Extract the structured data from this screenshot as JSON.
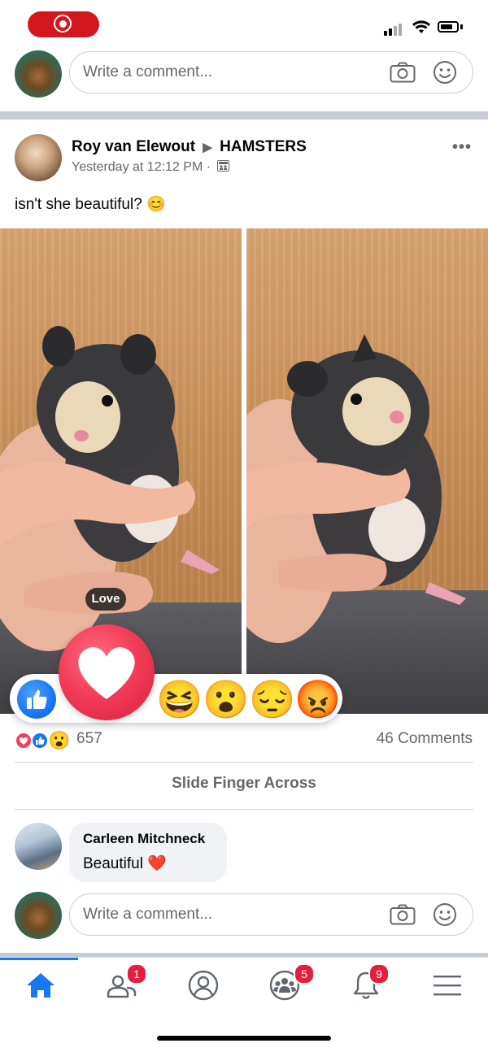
{
  "status_bar": {
    "recording": "screen-recording-indicator",
    "icons": [
      "signal-icon",
      "wifi-icon",
      "battery-icon"
    ]
  },
  "top_comment_box": {
    "placeholder": "Write a comment..."
  },
  "post": {
    "author": "Roy van Elewout",
    "arrow": "▶",
    "group": "HAMSTERS",
    "timestamp": "Yesterday at 12:12 PM ·",
    "text": "isn't she beautiful? 😊",
    "more_icon": "•••"
  },
  "reactions": {
    "tooltip": "Love",
    "options": [
      "like",
      "love",
      "haha",
      "wow",
      "sad",
      "angry"
    ],
    "emojis": {
      "haha": "😆",
      "wow": "😮",
      "sad": "😔",
      "angry": "😡"
    },
    "summary_count": "657",
    "comments_count": "46 Comments"
  },
  "hint": {
    "label": "Slide Finger Across"
  },
  "comment": {
    "author": "Carleen Mitchneck",
    "text": "Beautiful ❤️"
  },
  "bottom_comment_box": {
    "placeholder": "Write a comment..."
  },
  "nav": {
    "badges": {
      "friends": "1",
      "groups": "5",
      "notifications": "9"
    },
    "active_color": "#1877f2"
  }
}
